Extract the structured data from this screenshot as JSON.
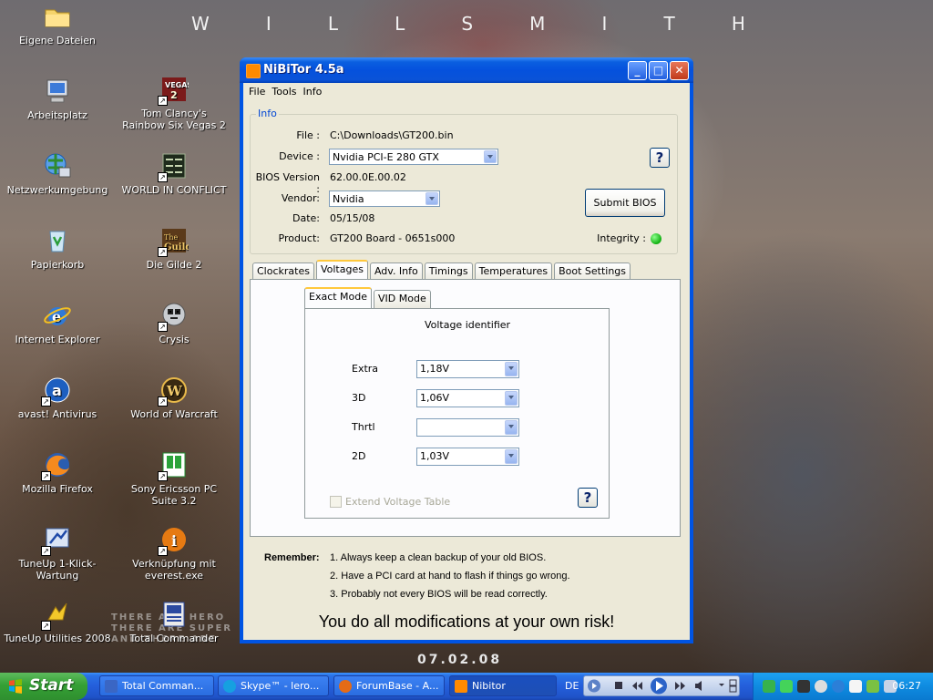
{
  "wallpaper": {
    "top_letters": [
      "W",
      "I",
      "L",
      "L",
      "S",
      "M",
      "I",
      "T",
      "H"
    ],
    "tagline": "THERE ARE HERO\nTHERE ARE SUPER\nAND THERE ARE",
    "date": "07.02.08"
  },
  "desktop_icons": [
    {
      "label": "Eigene Dateien",
      "icon": "folder-icon"
    },
    {
      "label": "Arbeitsplatz",
      "icon": "computer-icon"
    },
    {
      "label": "Netzwerkumgebung",
      "icon": "network-icon"
    },
    {
      "label": "Papierkorb",
      "icon": "recycle-bin-icon"
    },
    {
      "label": "Internet Explorer",
      "icon": "ie-icon"
    },
    {
      "label": "avast! Antivirus",
      "icon": "avast-icon"
    },
    {
      "label": "Mozilla Firefox",
      "icon": "firefox-icon"
    },
    {
      "label": "TuneUp 1-Klick-Wartung",
      "icon": "tuneup-icon"
    },
    {
      "label": "TuneUp Utilities 2008",
      "icon": "tuneup-utilities-icon"
    },
    {
      "label": "Tom Clancy's Rainbow Six Vegas 2",
      "icon": "vegas-icon"
    },
    {
      "label": "WORLD IN CONFLICT",
      "icon": "wic-icon"
    },
    {
      "label": "Die Gilde 2",
      "icon": "gilde-icon"
    },
    {
      "label": "Crysis",
      "icon": "crysis-icon"
    },
    {
      "label": "World of Warcraft",
      "icon": "wow-icon"
    },
    {
      "label": "Sony Ericsson PC Suite 3.2",
      "icon": "sony-icon"
    },
    {
      "label": "Verknüpfung mit everest.exe",
      "icon": "everest-icon"
    },
    {
      "label": "Total Commander",
      "icon": "total-commander-icon"
    }
  ],
  "window": {
    "title": "NiBiTor 4.5a",
    "menu": [
      "File",
      "Tools",
      "Info"
    ],
    "info": {
      "legend": "Info",
      "file_label": "File :",
      "file_value": "C:\\Downloads\\GT200.bin",
      "device_label": "Device :",
      "device_value": "Nvidia PCI-E 280 GTX",
      "bios_label": "BIOS Version :",
      "bios_value": "62.00.0E.00.02",
      "vendor_label": "Vendor:",
      "vendor_value": "Nvidia",
      "date_label": "Date:",
      "date_value": "05/15/08",
      "product_label": "Product:",
      "product_value": "GT200 Board - 0651s000",
      "submit_label": "Submit BIOS",
      "integrity_label": "Integrity :",
      "integrity_color": "#19c219"
    },
    "tabs": [
      "Clockrates",
      "Voltages",
      "Adv. Info",
      "Timings",
      "Temperatures",
      "Boot Settings"
    ],
    "active_tab": "Voltages",
    "subtabs": [
      "Exact Mode",
      "VID Mode"
    ],
    "voltage": {
      "heading": "Voltage identifier",
      "rows": [
        {
          "label": "Extra",
          "value": "1,18V"
        },
        {
          "label": "3D",
          "value": "1,06V"
        },
        {
          "label": "Thrtl",
          "value": ""
        },
        {
          "label": "2D",
          "value": "1,03V"
        }
      ],
      "extend_label": "Extend Voltage Table"
    },
    "notice": {
      "remember": "Remember:",
      "lines": [
        "1. Always keep a clean backup of your old BIOS.",
        "2. Have a PCI card at hand to flash if things go wrong.",
        "3. Probably not every BIOS will be read correctly."
      ],
      "warning": "You do all modifications at your own risk!"
    }
  },
  "taskbar": {
    "start": "Start",
    "tasks": [
      {
        "label": "Total Comman...",
        "color": "#3a66c4"
      },
      {
        "label": "Skype™ - lero...",
        "color": "#16a0e0"
      },
      {
        "label": "ForumBase - A...",
        "color": "#e46b17"
      },
      {
        "label": "Nibitor",
        "color": "#ff8a00"
      }
    ],
    "language": "DE",
    "clock": "06:27"
  }
}
